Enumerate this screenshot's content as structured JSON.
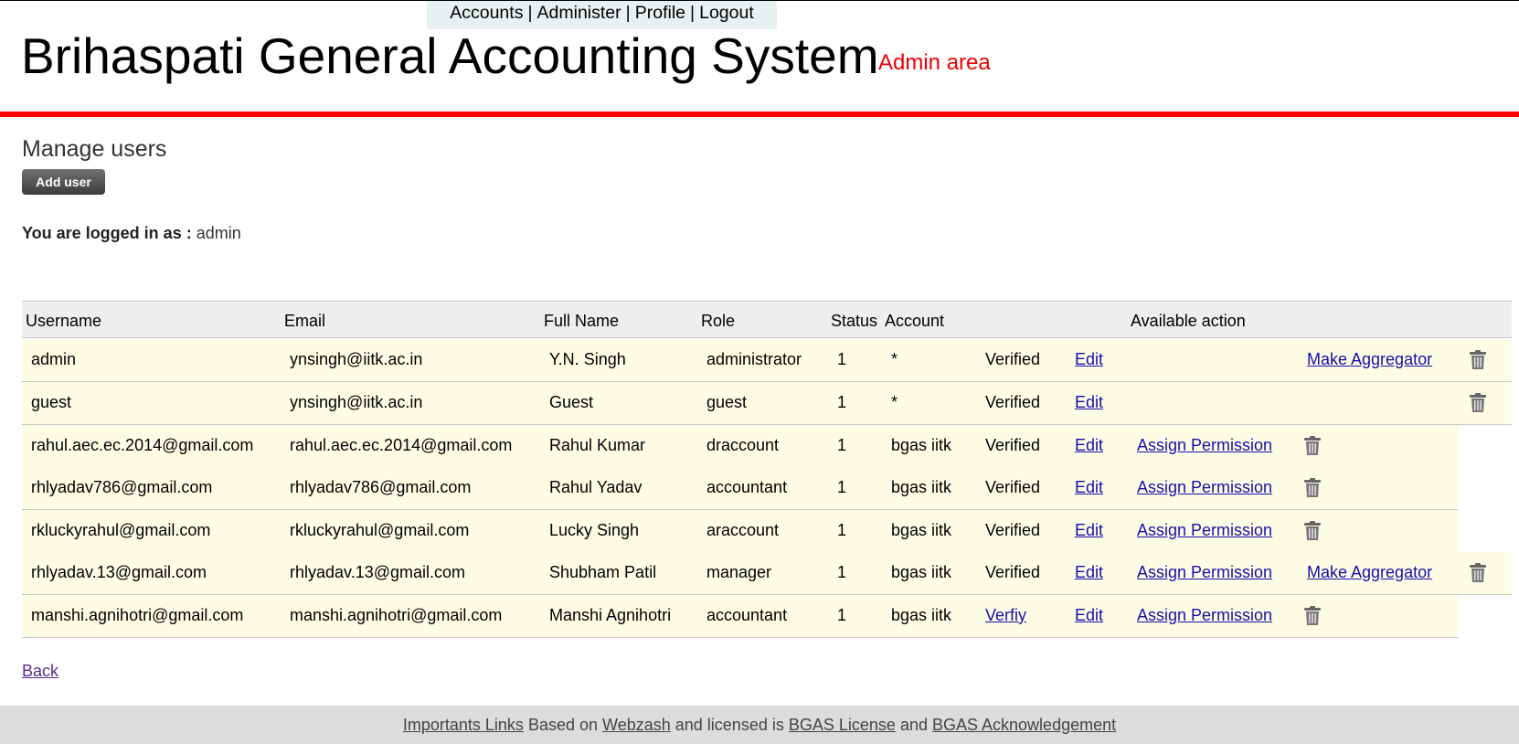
{
  "nav": {
    "accounts": "Accounts",
    "administer": "Administer",
    "profile": "Profile",
    "logout": "Logout",
    "sep": "|"
  },
  "header": {
    "title": "Brihaspati General Accounting System",
    "area": "Admin area"
  },
  "page": {
    "section_title": "Manage users",
    "add_user": "Add user",
    "logged_label": "You are logged in as :",
    "logged_user": "admin"
  },
  "table": {
    "headers": [
      "Username",
      "Email",
      "Full Name",
      "Role",
      "Status",
      "Account",
      "Available action"
    ],
    "rows": [
      [
        "admin",
        "ynsingh@iitk.ac.in",
        "Y.N. Singh",
        "administrator",
        "1",
        "*",
        "Verified",
        "Edit",
        "",
        "Make Aggregator"
      ],
      [
        "guest",
        "ynsingh@iitk.ac.in",
        "Guest",
        "guest",
        "1",
        "*",
        "Verified",
        "Edit",
        "",
        ""
      ],
      [
        "rahul.aec.ec.2014@gmail.com",
        "rahul.aec.ec.2014@gmail.com",
        "Rahul Kumar",
        "draccount",
        "1",
        "bgas iitk",
        "Verified",
        "Edit",
        "Assign Permission",
        ""
      ],
      [
        "rhlyadav786@gmail.com",
        "rhlyadav786@gmail.com",
        "Rahul Yadav",
        "accountant",
        "1",
        "bgas iitk",
        "Verified",
        "Edit",
        "Assign Permission",
        ""
      ],
      [
        "rkluckyrahul@gmail.com",
        "rkluckyrahul@gmail.com",
        "Lucky Singh",
        "araccount",
        "1",
        "bgas iitk",
        "Verified",
        "Edit",
        "Assign Permission",
        ""
      ],
      [
        "rhlyadav.13@gmail.com",
        "rhlyadav.13@gmail.com",
        "Shubham Patil",
        "manager",
        "1",
        "bgas iitk",
        "Verified",
        "Edit",
        "Assign Permission",
        "Make Aggregator"
      ],
      [
        "manshi.agnihotri@gmail.com",
        "manshi.agnihotri@gmail.com",
        "Manshi Agnihotri",
        "accountant",
        "1",
        "bgas iitk",
        "Verfiy",
        "Edit",
        "Assign Permission",
        ""
      ]
    ]
  },
  "back": "Back",
  "footer": {
    "links": "Importants Links",
    "based_on": "Based on",
    "webzash": "Webzash",
    "licensed": "and licensed is",
    "license": "BGAS License",
    "and": "and",
    "ack": "BGAS Acknowledgement"
  },
  "colors": {
    "accent_red": "#ff0000",
    "row_bg": "#fdfde6",
    "link": "#1a0dab"
  }
}
